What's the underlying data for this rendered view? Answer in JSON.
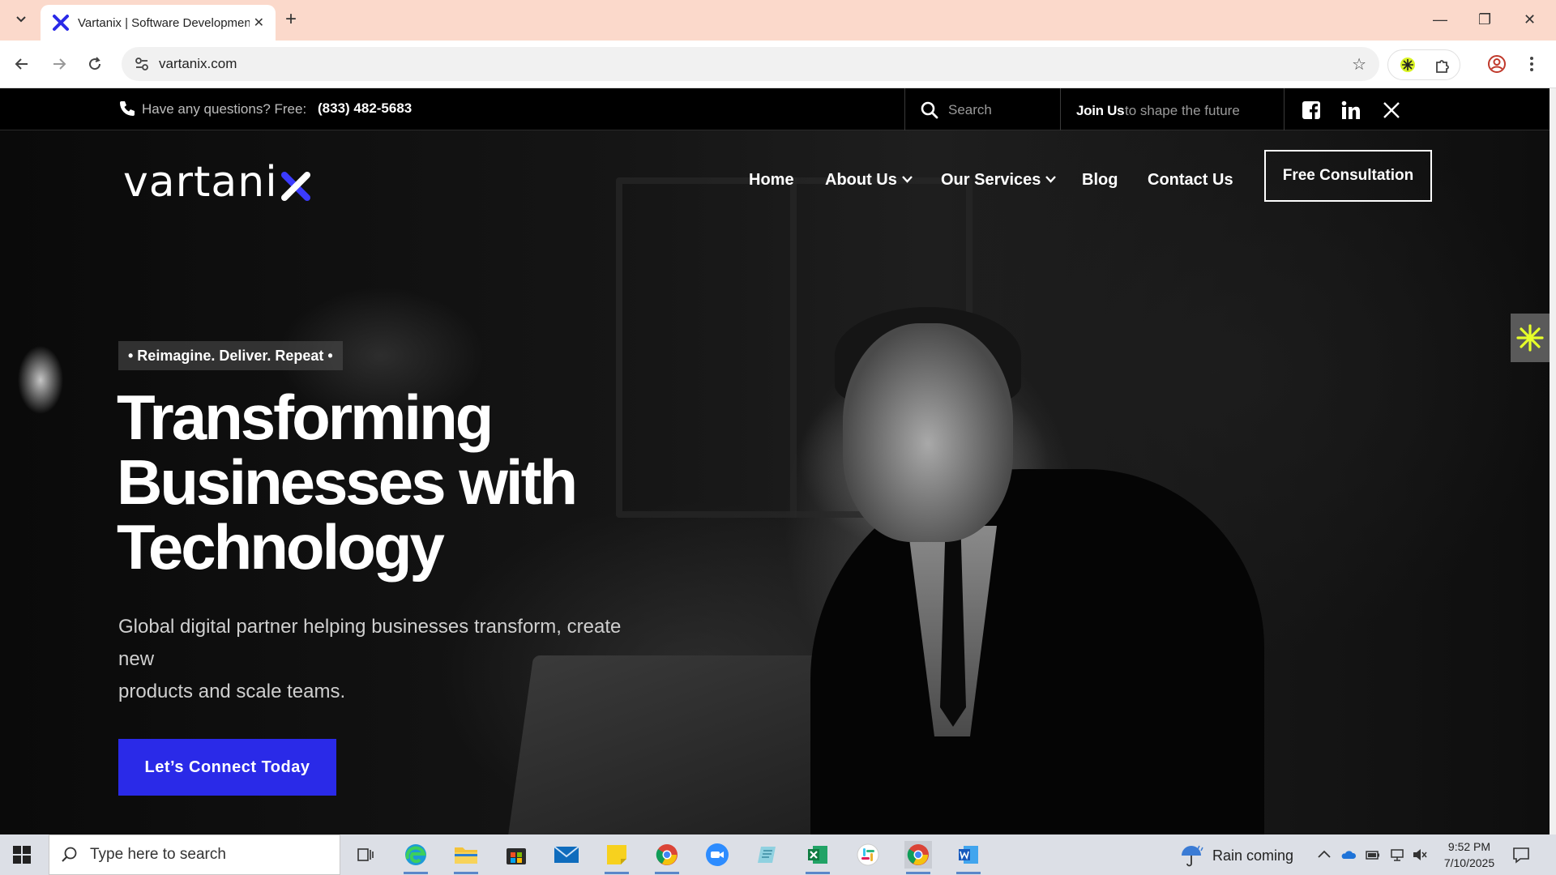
{
  "browser": {
    "tab_title": "Vartanix | Software Development",
    "url": "vartanix.com"
  },
  "topbar": {
    "question": "Have any questions? Free:",
    "phone": "(833) 482-5683",
    "search_placeholder": "Search",
    "join_bold": "Join Us",
    "join_rest": "to shape the future",
    "social": [
      "facebook-icon",
      "linkedin-icon",
      "x-icon"
    ]
  },
  "nav": {
    "logo": "vartani",
    "items": [
      {
        "label": "Home"
      },
      {
        "label": "About Us"
      },
      {
        "label": "Our Services"
      },
      {
        "label": "Blog"
      },
      {
        "label": "Contact Us"
      }
    ],
    "cta": "Free Consultation"
  },
  "hero": {
    "pill": "• Reimagine. Deliver. Repeat •",
    "title_lines": [
      "Transforming",
      "Businesses with",
      "Technology"
    ],
    "sub_lines": [
      "Global digital partner helping businesses transform, create",
      "new",
      "products and scale teams."
    ],
    "cta": "Let’s Connect Today"
  },
  "taskbar": {
    "search_placeholder": "Type here to search",
    "weather": "Rain coming",
    "time": "9:52 PM",
    "date": "7/10/2025"
  },
  "colors": {
    "accent_blue": "#2a2ae8",
    "tabbar": "#fbd9cb"
  }
}
